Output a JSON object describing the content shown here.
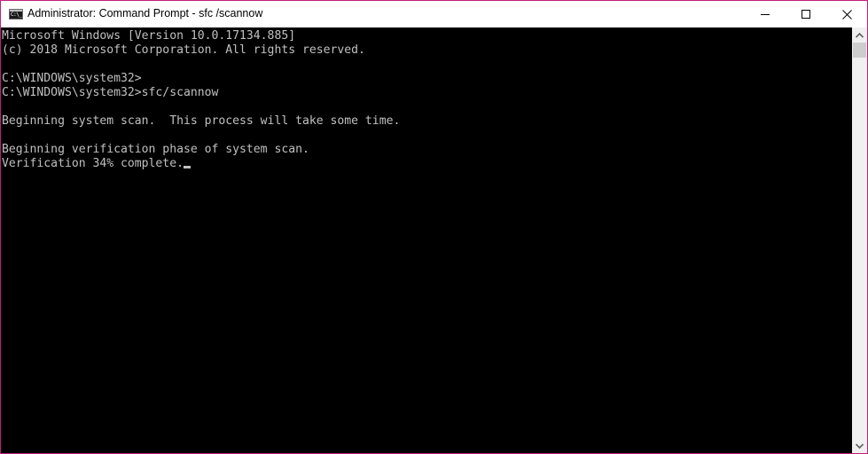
{
  "window": {
    "title": "Administrator: Command Prompt - sfc /scannow",
    "icon": "cmd-icon",
    "icon_text": "C:\\_",
    "controls": {
      "minimize": "minimize-icon",
      "maximize": "maximize-icon",
      "close": "close-icon"
    },
    "border_color": "#c41e7a"
  },
  "console": {
    "background": "#000000",
    "foreground": "#c0c0c0",
    "lines": [
      "Microsoft Windows [Version 10.0.17134.885]",
      "(c) 2018 Microsoft Corporation. All rights reserved.",
      "",
      "C:\\WINDOWS\\system32>",
      "C:\\WINDOWS\\system32>sfc/scannow",
      "",
      "Beginning system scan.  This process will take some time.",
      "",
      "Beginning verification phase of system scan.",
      "Verification 34% complete."
    ],
    "progress_percent": 34
  },
  "scrollbar": {
    "up_icon": "chevron-up-icon",
    "down_icon": "chevron-down-icon"
  }
}
